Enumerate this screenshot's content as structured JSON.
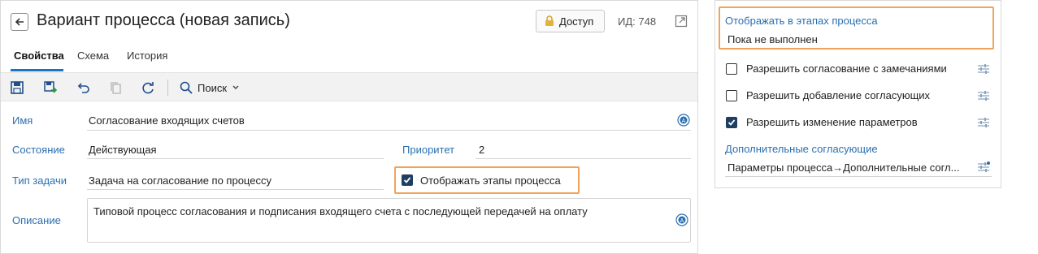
{
  "header": {
    "title": "Вариант процесса (новая запись)",
    "access_label": "Доступ",
    "id_label": "ИД: 748"
  },
  "tabs": [
    {
      "label": "Свойства",
      "active": true
    },
    {
      "label": "Схема",
      "active": false
    },
    {
      "label": "История",
      "active": false
    }
  ],
  "toolbar": {
    "search_label": "Поиск"
  },
  "form": {
    "name_label": "Имя",
    "name_value": "Согласование входящих счетов",
    "state_label": "Состояние",
    "state_value": "Действующая",
    "priority_label": "Приоритет",
    "priority_value": "2",
    "task_type_label": "Тип задачи",
    "task_type_value": "Задача на согласование по процессу",
    "show_stages_label": "Отображать этапы процесса",
    "show_stages_checked": true,
    "description_label": "Описание",
    "description_value": "Типовой процесс согласования и подписания входящего счета с последующей передачей на оплату"
  },
  "panel": {
    "stages_link": "Отображать в этапах процесса",
    "stages_value": "Пока не выполнен",
    "options": [
      {
        "label": "Разрешить согласование с замечаниями",
        "checked": false
      },
      {
        "label": "Разрешить добавление согласующих",
        "checked": false
      },
      {
        "label": "Разрешить изменение параметров",
        "checked": true
      }
    ],
    "extra_label": "Дополнительные согласующие",
    "extra_value": "Параметры процесса→Дополнительные согл..."
  },
  "colors": {
    "accent": "#2a6fb0",
    "highlight": "#f0a35a",
    "checkbox": "#1f3e63",
    "toolbar_bg": "#f2f2f2"
  }
}
